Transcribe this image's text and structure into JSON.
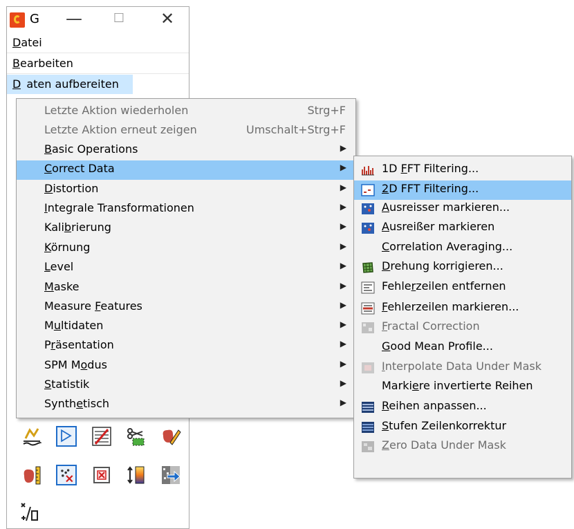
{
  "window": {
    "title": "G",
    "minimize_glyph": "—",
    "maximize_glyph": "☐",
    "close_glyph": "✕"
  },
  "menubar": {
    "datei": "Datei",
    "bearbeiten": "Bearbeiten",
    "daten": "Daten aufbereiten"
  },
  "main_menu": {
    "items": [
      {
        "label": "Letzte Aktion wiederholen",
        "shortcut": "Strg+F",
        "disabled": true
      },
      {
        "label": "Letzte Aktion erneut zeigen",
        "shortcut": "Umschalt+Strg+F",
        "disabled": true
      },
      {
        "label": "Basic Operations",
        "submenu": true
      },
      {
        "label": "Correct Data",
        "submenu": true,
        "highlighted": true
      },
      {
        "label": "Distortion",
        "submenu": true
      },
      {
        "label": "Integrale Transformationen",
        "submenu": true
      },
      {
        "label": "Kalibrierung",
        "submenu": true
      },
      {
        "label": "Körnung",
        "submenu": true
      },
      {
        "label": "Level",
        "submenu": true
      },
      {
        "label": "Maske",
        "submenu": true
      },
      {
        "label": "Measure Features",
        "submenu": true
      },
      {
        "label": "Multidaten",
        "submenu": true
      },
      {
        "label": "Präsentation",
        "submenu": true
      },
      {
        "label": "SPM Modus",
        "submenu": true
      },
      {
        "label": "Statistik",
        "submenu": true
      },
      {
        "label": "Synthetisch",
        "submenu": true
      }
    ],
    "arrow_glyph": "▶"
  },
  "sub_menu": {
    "items": [
      {
        "label": "1D FFT Filtering...",
        "icon": "fft-1d-icon"
      },
      {
        "label": "2D FFT Filtering...",
        "icon": "fft-2d-icon",
        "highlighted": true
      },
      {
        "label": "Ausreisser markieren...",
        "icon": "outlier-icon"
      },
      {
        "label": "Ausreißer markieren",
        "icon": "outlier-icon"
      },
      {
        "label": "Correlation Averaging...",
        "icon": ""
      },
      {
        "label": "Drehung korrigieren...",
        "icon": "rotate-grid-icon"
      },
      {
        "label": "Fehlerzeilen entfernen",
        "icon": "scanline-remove-icon"
      },
      {
        "label": "Fehlerzeilen markieren...",
        "icon": "scanline-mark-icon"
      },
      {
        "label": "Fractal Correction",
        "icon": "fractal-icon",
        "disabled": true
      },
      {
        "label": "Good Mean Profile...",
        "icon": ""
      },
      {
        "label": "Interpolate Data Under Mask",
        "icon": "interpolate-mask-icon",
        "disabled": true
      },
      {
        "label": "Markiere invertierte Reihen",
        "icon": ""
      },
      {
        "label": "Reihen anpassen...",
        "icon": "rows-align-icon"
      },
      {
        "label": "Stufen Zeilenkorrektur",
        "icon": "step-line-correction-icon"
      },
      {
        "label": "Zero Data Under Mask",
        "icon": "zero-mask-icon",
        "disabled": true
      }
    ]
  },
  "colors": {
    "highlight": "#91c9f7",
    "menubar_highlight": "#cce8ff",
    "menu_bg": "#f2f2f2",
    "disabled_text": "#6d6d6d",
    "app_icon": "#e8471a"
  }
}
